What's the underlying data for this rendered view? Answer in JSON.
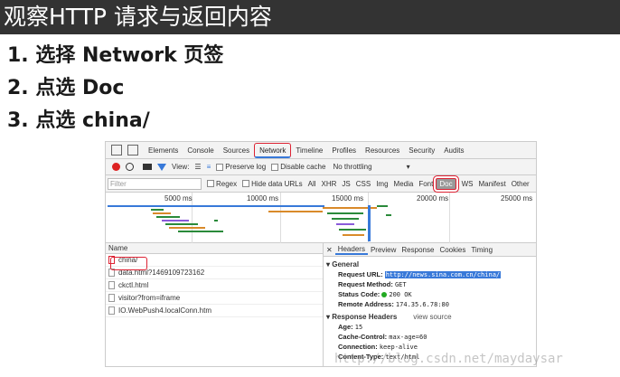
{
  "header": {
    "title": "观察HTTP 请求与返回内容"
  },
  "steps": [
    "1.  选择 Network 页签",
    "2.  点选 Doc",
    "3.  点选 china/"
  ],
  "devtools": {
    "tabs": [
      "Elements",
      "Console",
      "Sources",
      "Network",
      "Timeline",
      "Profiles",
      "Resources",
      "Security",
      "Audits"
    ],
    "active_tab": "Network",
    "toolbar": {
      "view_label": "View:",
      "preserve_log": "Preserve log",
      "disable_cache": "Disable cache",
      "throttle": "No throttling"
    },
    "filter": {
      "placeholder": "Filter",
      "regex": "Regex",
      "hide_data_urls": "Hide data URLs",
      "types": [
        "All",
        "XHR",
        "JS",
        "CSS",
        "Img",
        "Media",
        "Font",
        "Doc",
        "WS",
        "Manifest",
        "Other"
      ],
      "selected_type": "Doc"
    },
    "timeline": {
      "ticks": [
        "5000 ms",
        "10000 ms",
        "15000 ms",
        "20000 ms",
        "25000 ms"
      ]
    },
    "requests": {
      "column": "Name",
      "items": [
        "china/",
        "data.html?1469109723162",
        "ckctl.html",
        "visitor?from=iframe",
        "IO.WebPush4.localConn.htm"
      ]
    },
    "detail": {
      "tabs": [
        "Headers",
        "Preview",
        "Response",
        "Cookies",
        "Timing"
      ],
      "general_title": "General",
      "general": [
        {
          "k": "Request URL:",
          "v": "http://news.sina.com.cn/china/"
        },
        {
          "k": "Request Method:",
          "v": "GET"
        },
        {
          "k": "Status Code:",
          "v": "200 OK"
        },
        {
          "k": "Remote Address:",
          "v": "174.35.6.78:80"
        }
      ],
      "response_title": "Response Headers",
      "view_source": "view source",
      "response": [
        {
          "k": "Age:",
          "v": "15"
        },
        {
          "k": "Cache-Control:",
          "v": "max-age=60"
        },
        {
          "k": "Connection:",
          "v": "keep-alive"
        },
        {
          "k": "Content-Type:",
          "v": "text/html"
        }
      ]
    }
  },
  "watermark": "http://blog.csdn.net/maydaysar",
  "colors": {
    "accent": "#3879d9",
    "highlight": "#dd2233",
    "title_bg": "#333333"
  }
}
